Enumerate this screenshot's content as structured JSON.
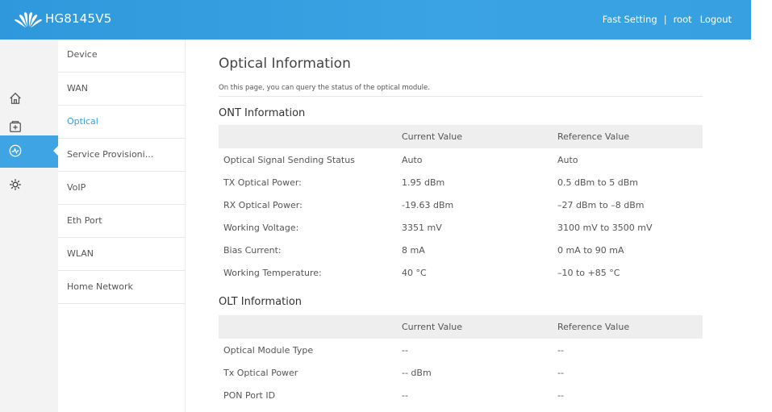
{
  "header": {
    "model": "HG8145V5",
    "links": {
      "fast_setting": "Fast Setting",
      "separator": "|",
      "user": "root",
      "logout": "Logout"
    },
    "brand_color": "#2f98dc"
  },
  "sidebar_icons": [
    {
      "name": "home-icon"
    },
    {
      "name": "add-box-icon"
    },
    {
      "name": "network-status-icon",
      "active": true
    },
    {
      "name": "gear-icon"
    }
  ],
  "menu": {
    "items": [
      {
        "label": "Device"
      },
      {
        "label": "WAN"
      },
      {
        "label": "Optical",
        "active": true
      },
      {
        "label": "Service Provisioni..."
      },
      {
        "label": "VoIP"
      },
      {
        "label": "Eth Port"
      },
      {
        "label": "WLAN"
      },
      {
        "label": "Home Network"
      }
    ]
  },
  "page": {
    "title": "Optical Information",
    "description": "On this page, you can query the status of the optical module."
  },
  "ont": {
    "title": "ONT Information",
    "headers": [
      "",
      "Current Value",
      "Reference Value"
    ],
    "rows": [
      [
        "Optical Signal Sending Status",
        "Auto",
        "Auto"
      ],
      [
        "TX Optical Power:",
        "1.95 dBm",
        "0.5 dBm to 5 dBm"
      ],
      [
        "RX Optical Power:",
        "-19.63 dBm",
        "–27 dBm to –8 dBm"
      ],
      [
        "Working Voltage:",
        "3351 mV",
        "3100 mV to 3500 mV"
      ],
      [
        "Bias Current:",
        "8 mA",
        "0 mA to 90 mA"
      ],
      [
        "Working Temperature:",
        "40 °C",
        "–10 to +85 °C"
      ]
    ]
  },
  "olt": {
    "title": "OLT Information",
    "headers": [
      "",
      "Current Value",
      "Reference Value"
    ],
    "rows": [
      [
        "Optical Module Type",
        "--",
        "--"
      ],
      [
        "Tx Optical Power",
        "-- dBm",
        "--"
      ],
      [
        "PON Port ID",
        "--",
        "--"
      ]
    ]
  }
}
